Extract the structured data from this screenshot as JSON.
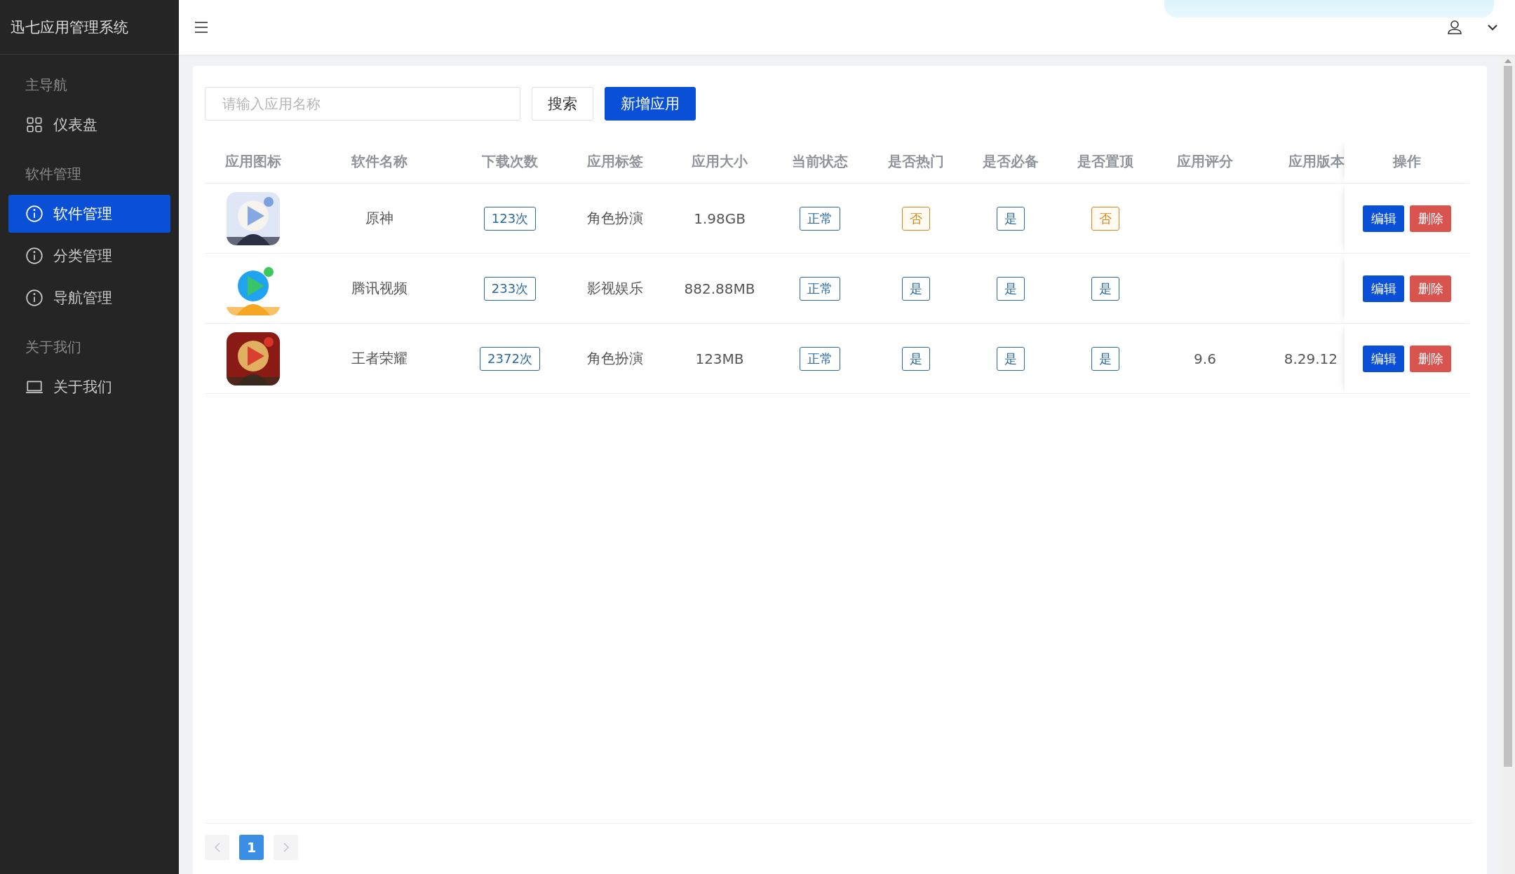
{
  "app": {
    "title": "迅七应用管理系统"
  },
  "sidebar": {
    "groups": [
      {
        "label": "主导航",
        "items": [
          {
            "label": "仪表盘",
            "selected": false
          }
        ]
      },
      {
        "label": "软件管理",
        "items": [
          {
            "label": "软件管理",
            "selected": true
          },
          {
            "label": "分类管理",
            "selected": false
          },
          {
            "label": "导航管理",
            "selected": false
          }
        ]
      },
      {
        "label": "关于我们",
        "items": [
          {
            "label": "关于我们",
            "selected": false
          }
        ]
      }
    ]
  },
  "toolbar": {
    "search": {
      "placeholder": "请输入应用名称"
    },
    "search_button": "搜索",
    "add_button": "新增应用"
  },
  "table": {
    "columns": [
      "应用图标",
      "软件名称",
      "下载次数",
      "应用标签",
      "应用大小",
      "当前状态",
      "是否热门",
      "是否必备",
      "是否置顶",
      "应用评分",
      "应用版本",
      "操作"
    ],
    "rows": [
      {
        "icon": {
          "kind": "picture"
        },
        "name": "原神",
        "downloads": "123次",
        "tag": "角色扮演",
        "size": "1.98GB",
        "status": "正常",
        "hot": {
          "text": "否",
          "kind": "no"
        },
        "must": {
          "text": "是",
          "kind": "yes"
        },
        "top": {
          "text": "否",
          "kind": "no"
        },
        "actions": [
          "编辑",
          "删除"
        ]
      },
      {
        "icon": {
          "kind": "picture"
        },
        "name": "腾讯视频",
        "downloads": "233次",
        "tag": "影视娱乐",
        "size": "882.88MB",
        "status": "正常",
        "hot": {
          "text": "是",
          "kind": "yes"
        },
        "must": {
          "text": "是",
          "kind": "yes"
        },
        "top": {
          "text": "是",
          "kind": "yes"
        },
        "actions": [
          "编辑",
          "删除"
        ]
      },
      {
        "icon": {
          "kind": "picture"
        },
        "name": "王者荣耀",
        "downloads": "2372次",
        "tag": "角色扮演",
        "size": "123MB",
        "status": "正常",
        "hot": {
          "text": "是",
          "kind": "yes"
        },
        "must": {
          "text": "是",
          "kind": "yes"
        },
        "top": {
          "text": "是",
          "kind": "yes"
        },
        "rating": "9.6",
        "version": "8.29.12",
        "actions": [
          "编辑",
          "删除"
        ]
      }
    ]
  },
  "pagination": {
    "pages": [
      {
        "label": "1",
        "selected": true
      }
    ]
  }
}
